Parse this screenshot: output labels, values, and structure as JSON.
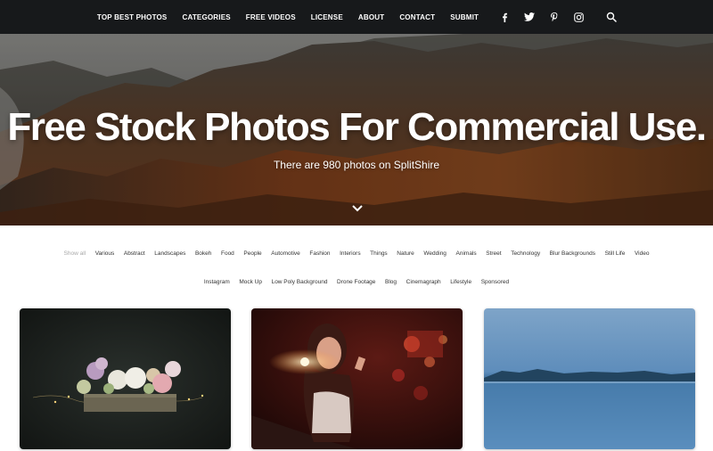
{
  "nav": {
    "links": [
      {
        "label": "TOP BEST PHOTOS",
        "name": "nav-top-best-photos"
      },
      {
        "label": "CATEGORIES",
        "name": "nav-categories"
      },
      {
        "label": "FREE VIDEOS",
        "name": "nav-free-videos"
      },
      {
        "label": "LICENSE",
        "name": "nav-license"
      },
      {
        "label": "ABOUT",
        "name": "nav-about"
      },
      {
        "label": "CONTACT",
        "name": "nav-contact"
      },
      {
        "label": "SUBMIT",
        "name": "nav-submit"
      }
    ],
    "icons": [
      "facebook-icon",
      "twitter-icon",
      "pinterest-icon",
      "instagram-icon",
      "search-icon"
    ]
  },
  "hero": {
    "title": "Free Stock Photos For Commercial Use.",
    "subtitle": "There are 980 photos on SplitShire",
    "scroll_icon": "chevron-down-icon"
  },
  "categories": {
    "active": "Show all",
    "items": [
      "Show all",
      "Various",
      "Abstract",
      "Landscapes",
      "Bokeh",
      "Food",
      "People",
      "Automotive",
      "Fashion",
      "Interiors",
      "Things",
      "Nature",
      "Wedding",
      "Animals",
      "Street",
      "Technology",
      "Blur Backgrounds",
      "Still Life",
      "Video",
      "Instagram",
      "Mock Up",
      "Low Poly Background",
      "Drone Footage",
      "Blog",
      "Cinemagraph",
      "Lifestyle",
      "Sponsored"
    ]
  },
  "photos": [
    {
      "name": "photo-flowers-box"
    },
    {
      "name": "photo-woman-lipstick"
    },
    {
      "name": "photo-blue-lake"
    }
  ],
  "colors": {
    "nav_bg": "#17191b",
    "nav_text": "#ffffff",
    "category_active": "#a8a8a8",
    "category_text": "#333333"
  }
}
